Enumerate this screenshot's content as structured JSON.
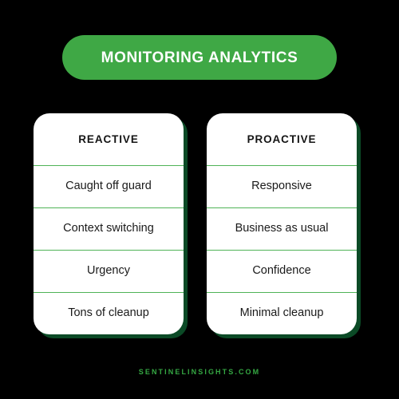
{
  "background_color": "#000000",
  "accent_color": "#3fa845",
  "divider_color": "#4fb357",
  "shadow_color": "#0b4a26",
  "title": {
    "label": "MONITORING ANALYTICS"
  },
  "columns": [
    {
      "header": "REACTIVE",
      "rows": [
        "Caught off guard",
        "Context switching",
        "Urgency",
        "Tons of cleanup"
      ]
    },
    {
      "header": "PROACTIVE",
      "rows": [
        "Responsive",
        "Business as usual",
        "Confidence",
        "Minimal cleanup"
      ]
    }
  ],
  "footer": {
    "label": "SENTINELINSIGHTS.COM"
  }
}
